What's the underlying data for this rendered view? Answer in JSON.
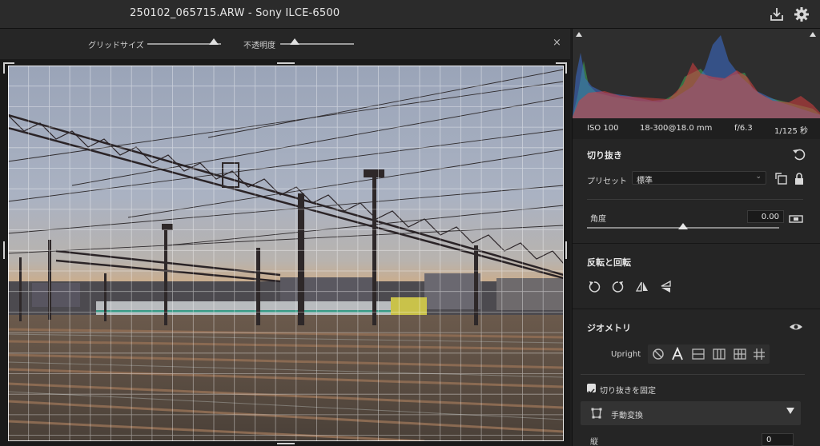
{
  "window": {
    "title": "250102_065715.ARW  -  Sony ILCE-6500"
  },
  "grid_toolbar": {
    "grid_size_label": "グリッドサイズ",
    "opacity_label": "不透明度",
    "grid_size_value": 0.9,
    "opacity_value": 0.2,
    "close_glyph": "×"
  },
  "exif": {
    "iso": "ISO 100",
    "lens": "18-300@18.0 mm",
    "aperture": "f/6.3",
    "shutter": "1/125 秒"
  },
  "crop": {
    "title": "切り抜き",
    "preset_label": "プリセット",
    "preset_value": "標準",
    "angle_label": "角度",
    "angle_value": "0.00",
    "angle_slider": 0.5
  },
  "rotate": {
    "title": "反転と回転"
  },
  "geometry": {
    "title": "ジオメトリ",
    "upright_label": "Upright",
    "constrain_label": "切り抜きを固定",
    "manual_label": "手動変換",
    "vertical_label": "縦",
    "vertical_value": "0"
  },
  "icons": {
    "export": "export-icon",
    "settings": "gear-icon",
    "reset": "reset-icon",
    "aspect": "aspect-swap-icon",
    "lock": "lock-icon",
    "level": "level-tool-icon",
    "eye": "eye-icon"
  },
  "colors": {
    "background": "#1e1e1e",
    "panel": "#252525",
    "histogram_red": "#d94040",
    "histogram_green": "#3fae5a",
    "histogram_blue": "#3d6fd1"
  }
}
